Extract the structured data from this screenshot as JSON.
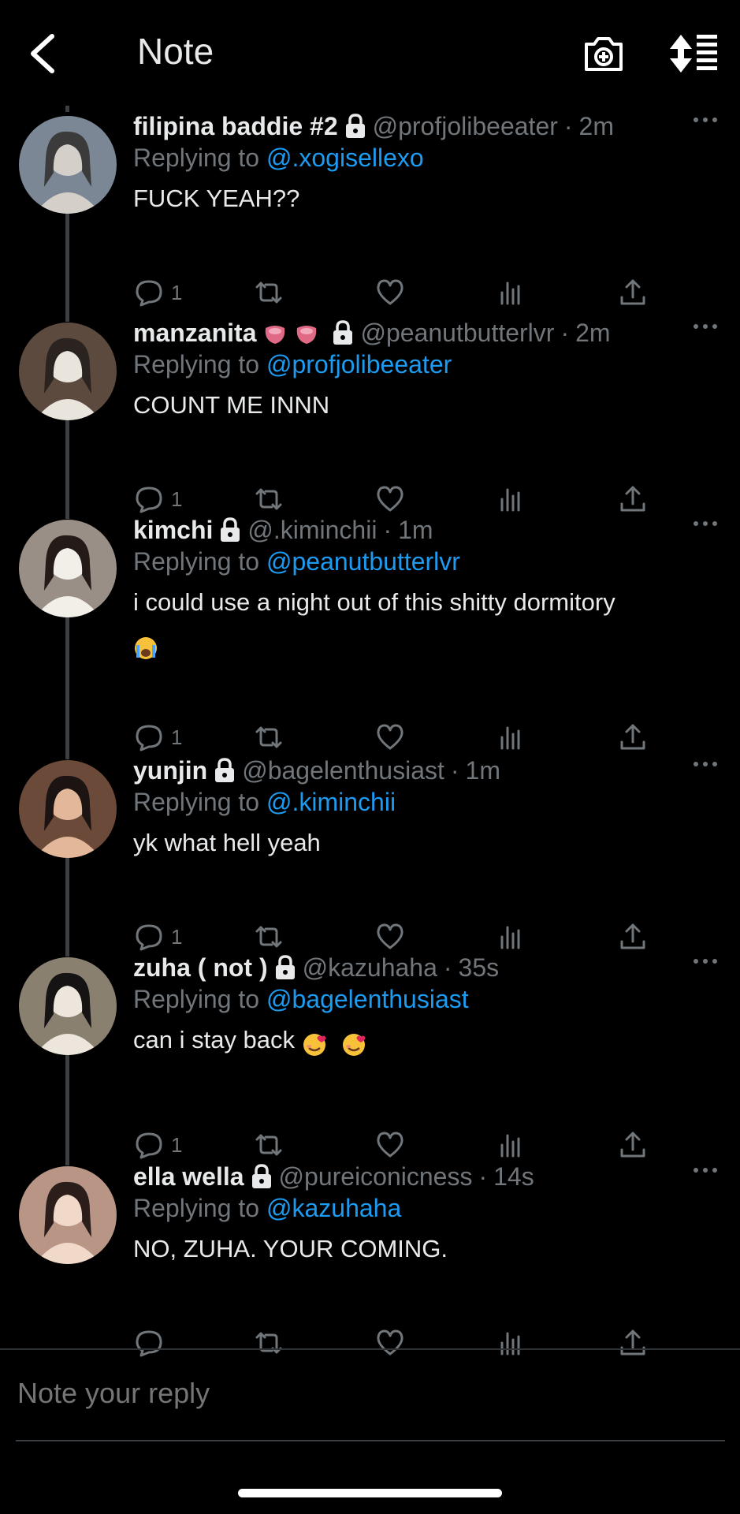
{
  "header": {
    "title": "Note"
  },
  "replies": [
    {
      "name": "filipina baddie #2",
      "emoji": [],
      "handle": "@profjolibeeater",
      "time": "2m",
      "replying_label": "Replying to",
      "replying_to": "@.xogisellexo",
      "text": "FUCK YEAH??",
      "text_emoji": [],
      "reply_count": "1"
    },
    {
      "name": "manzanita",
      "emoji": [
        "blush-emoji",
        "blush-emoji"
      ],
      "handle": "@peanutbutterlvr",
      "time": "2m",
      "replying_label": "Replying to",
      "replying_to": "@profjolibeeater",
      "text": "COUNT ME INNN",
      "text_emoji": [],
      "reply_count": "1"
    },
    {
      "name": "kimchi",
      "emoji": [],
      "handle": "@.kiminchii",
      "time": "1m",
      "replying_label": "Replying to",
      "replying_to": "@peanutbutterlvr",
      "text": "i could use a night out of this shitty dormitory",
      "text_emoji": [
        "crying-face-emoji"
      ],
      "reply_count": "1"
    },
    {
      "name": "yunjin",
      "emoji": [],
      "handle": "@bagelenthusiast",
      "time": "1m",
      "replying_label": "Replying to",
      "replying_to": "@.kiminchii",
      "text": "yk what hell yeah",
      "text_emoji": [],
      "reply_count": "1"
    },
    {
      "name": "zuha ( not )",
      "emoji": [],
      "handle": "@kazuhaha",
      "time": "35s",
      "replying_label": "Replying to",
      "replying_to": "@bagelenthusiast",
      "text": "can i stay back",
      "text_emoji": [
        "smiling-hearts-emoji",
        "smiling-hearts-emoji"
      ],
      "reply_count": "1"
    },
    {
      "name": "ella wella",
      "emoji": [],
      "handle": "@pureiconicness",
      "time": "14s",
      "replying_label": "Replying to",
      "replying_to": "@kazuhaha",
      "text": "NO, ZUHA. YOUR COMING.",
      "text_emoji": [],
      "reply_count": ""
    }
  ],
  "composer": {
    "placeholder": "Note your reply"
  },
  "colors": {
    "background": "#000000",
    "text": "#e7e9ea",
    "muted": "#71767b",
    "link": "#1d9bf0"
  },
  "icons": [
    "back-arrow-icon",
    "camera-plus-icon",
    "sort-icon",
    "lock-icon",
    "more-icon",
    "comment-icon",
    "retweet-icon",
    "like-icon",
    "views-icon",
    "share-icon"
  ]
}
